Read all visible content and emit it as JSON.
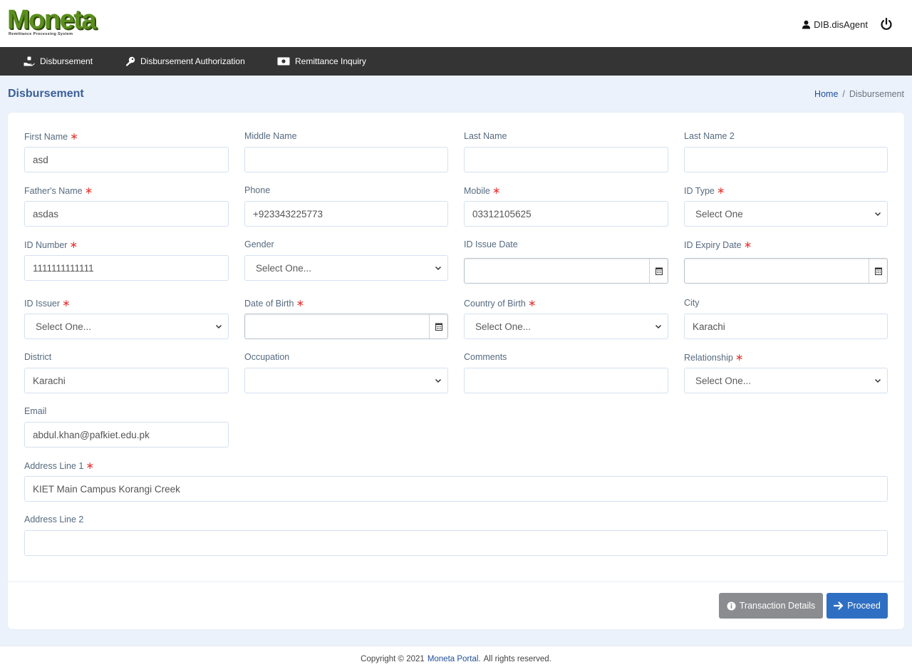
{
  "header": {
    "logo": {
      "word": "Moneta",
      "tagline": "Remittance Processing System"
    },
    "user_name": "DIB.disAgent"
  },
  "nav": {
    "items": [
      {
        "label": "Disbursement",
        "icon": "hand-holding-icon"
      },
      {
        "label": "Disbursement Authorization",
        "icon": "key-icon"
      },
      {
        "label": "Remittance Inquiry",
        "icon": "money-bill-icon"
      }
    ]
  },
  "page": {
    "title": "Disbursement",
    "breadcrumb": {
      "home": "Home",
      "separator": "/",
      "current": "Disbursement"
    }
  },
  "form": {
    "first_name": {
      "label": "First Name",
      "required": "∗",
      "value": "asd"
    },
    "middle_name": {
      "label": "Middle Name",
      "value": ""
    },
    "last_name": {
      "label": "Last Name",
      "value": ""
    },
    "last_name_2": {
      "label": "Last Name 2",
      "value": ""
    },
    "father_name": {
      "label": "Father's Name",
      "required": "∗",
      "value": "asdas"
    },
    "phone": {
      "label": "Phone",
      "value": "+923343225773"
    },
    "mobile": {
      "label": "Mobile",
      "required": "∗",
      "value": "03312105625"
    },
    "id_type": {
      "label": "ID Type",
      "required": "∗",
      "selected": "Select One"
    },
    "id_number": {
      "label": "ID Number",
      "required": "∗",
      "value": "1111111111111"
    },
    "gender": {
      "label": "Gender",
      "selected": "Select One..."
    },
    "id_issue_date": {
      "label": "ID Issue Date",
      "value": ""
    },
    "id_expiry_date": {
      "label": "ID Expiry Date",
      "required": "∗",
      "value": ""
    },
    "id_issuer": {
      "label": "ID Issuer",
      "required": "∗",
      "selected": "Select One..."
    },
    "date_of_birth": {
      "label": "Date of Birth",
      "required": "∗",
      "value": ""
    },
    "country_of_birth": {
      "label": "Country of Birth",
      "required": "∗",
      "selected": "Select One..."
    },
    "city": {
      "label": "City",
      "value": "Karachi"
    },
    "district": {
      "label": "District",
      "value": "Karachi"
    },
    "occupation": {
      "label": "Occupation",
      "selected": ""
    },
    "comments": {
      "label": "Comments",
      "value": ""
    },
    "relationship": {
      "label": "Relationship",
      "required": "∗",
      "selected": "Select One..."
    },
    "email": {
      "label": "Email",
      "value": "abdul.khan@pafkiet.edu.pk"
    },
    "address_1": {
      "label": "Address Line 1",
      "required": "∗",
      "value": "KIET Main Campus Korangi Creek"
    },
    "address_2": {
      "label": "Address Line 2",
      "value": ""
    }
  },
  "actions": {
    "details_label": "Transaction Details",
    "proceed_label": "Proceed"
  },
  "footer": {
    "prefix": "Copyright © 2021",
    "brand": "Moneta Portal",
    "suffix": "All rights reserved."
  },
  "colors": {
    "nav_bg": "#343434",
    "title_blue": "#3b5f9a",
    "required_red": "#e53935",
    "proceed_blue": "#2f6fc3",
    "details_gray": "#8a8c8f",
    "logo_green": "#5b8f1d"
  }
}
